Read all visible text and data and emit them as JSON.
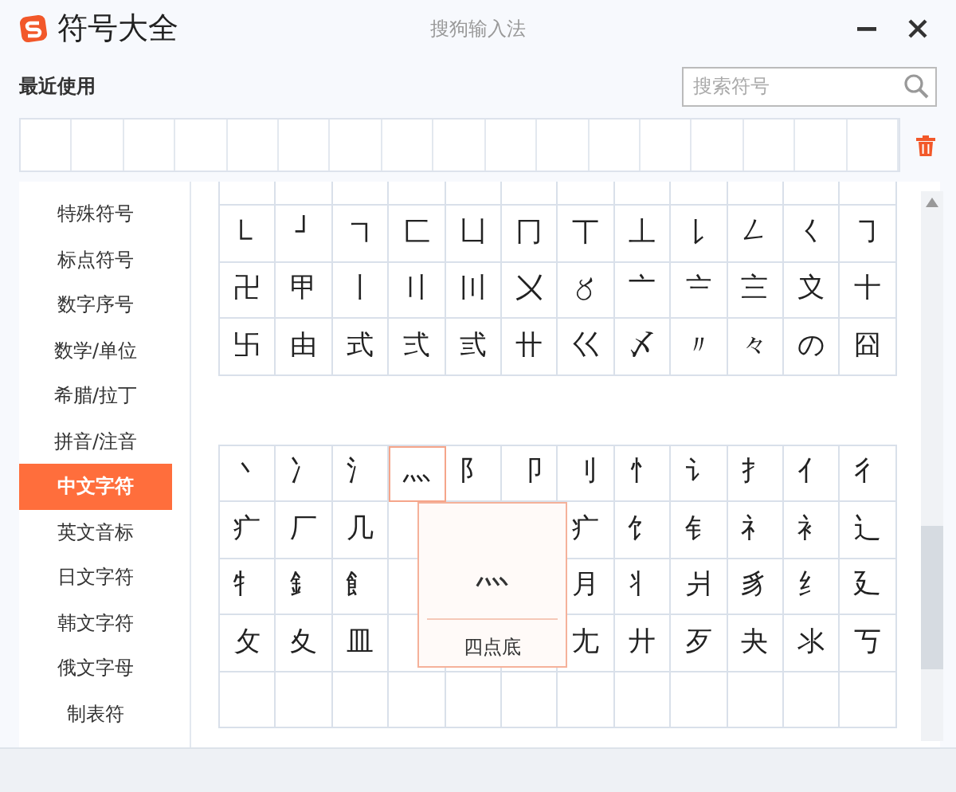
{
  "window": {
    "title": "符号大全",
    "app_name": "搜狗输入法"
  },
  "recent": {
    "title": "最近使用"
  },
  "search": {
    "placeholder": "搜索符号"
  },
  "categories": [
    {
      "label": "特殊符号",
      "selected": false
    },
    {
      "label": "标点符号",
      "selected": false
    },
    {
      "label": "数字序号",
      "selected": false
    },
    {
      "label": "数学/单位",
      "selected": false
    },
    {
      "label": "希腊/拉丁",
      "selected": false
    },
    {
      "label": "拼音/注音",
      "selected": false
    },
    {
      "label": "中文字符",
      "selected": true
    },
    {
      "label": "英文音标",
      "selected": false
    },
    {
      "label": "日文字符",
      "selected": false
    },
    {
      "label": "韩文字符",
      "selected": false
    },
    {
      "label": "俄文字母",
      "selected": false
    },
    {
      "label": "制表符",
      "selected": false
    }
  ],
  "sections": [
    {
      "rows": [
        [
          {
            "symbol": "㇄",
            "hovered": false
          },
          {
            "symbol": "┘",
            "hovered": false
          },
          {
            "symbol": "㇕",
            "hovered": false
          },
          {
            "symbol": "匚",
            "hovered": false
          },
          {
            "symbol": "凵",
            "hovered": false
          },
          {
            "symbol": "冂",
            "hovered": false
          },
          {
            "symbol": "丅",
            "hovered": false
          },
          {
            "symbol": "丄",
            "hovered": false
          },
          {
            "symbol": "㇙",
            "hovered": false
          },
          {
            "symbol": "㇜",
            "hovered": false
          },
          {
            "symbol": "㇛",
            "hovered": false
          },
          {
            "symbol": "㇆",
            "hovered": false
          }
        ],
        [
          {
            "symbol": "卍",
            "hovered": false
          },
          {
            "symbol": "甲",
            "hovered": false
          },
          {
            "symbol": "〡",
            "hovered": false
          },
          {
            "symbol": "〢",
            "hovered": false
          },
          {
            "symbol": "〣",
            "hovered": false
          },
          {
            "symbol": "〤",
            "hovered": false
          },
          {
            "symbol": "〥",
            "hovered": false
          },
          {
            "symbol": "〦",
            "hovered": false
          },
          {
            "symbol": "〧",
            "hovered": false
          },
          {
            "symbol": "〨",
            "hovered": false
          },
          {
            "symbol": "〩",
            "hovered": false
          },
          {
            "symbol": "〸",
            "hovered": false
          }
        ],
        [
          {
            "symbol": "卐",
            "hovered": false
          },
          {
            "symbol": "由",
            "hovered": false
          },
          {
            "symbol": "式",
            "hovered": false
          },
          {
            "symbol": "弍",
            "hovered": false
          },
          {
            "symbol": "弎",
            "hovered": false
          },
          {
            "symbol": "〹",
            "hovered": false
          },
          {
            "symbol": "巜",
            "hovered": false
          },
          {
            "symbol": "〆",
            "hovered": false
          },
          {
            "symbol": "〃",
            "hovered": false
          },
          {
            "symbol": "々",
            "hovered": false
          },
          {
            "symbol": "の",
            "hovered": false
          },
          {
            "symbol": "囧",
            "hovered": false
          }
        ]
      ]
    },
    {
      "rows": [
        [
          {
            "symbol": "丶",
            "hovered": false
          },
          {
            "symbol": "冫",
            "hovered": false
          },
          {
            "symbol": "氵",
            "hovered": false
          },
          {
            "symbol": "灬",
            "hovered": true
          },
          {
            "symbol": "阝",
            "hovered": false
          },
          {
            "symbol": "卩",
            "hovered": false
          },
          {
            "symbol": "刂",
            "hovered": false
          },
          {
            "symbol": "忄",
            "hovered": false
          },
          {
            "symbol": "讠",
            "hovered": false
          },
          {
            "symbol": "扌",
            "hovered": false
          },
          {
            "symbol": "亻",
            "hovered": false
          },
          {
            "symbol": "彳",
            "hovered": false
          }
        ],
        [
          {
            "symbol": "疒",
            "hovered": false
          },
          {
            "symbol": "厂",
            "hovered": false
          },
          {
            "symbol": "几",
            "hovered": false
          },
          null,
          null,
          null,
          {
            "symbol": "疒",
            "hovered": false
          },
          {
            "symbol": "饣",
            "hovered": false
          },
          {
            "symbol": "钅",
            "hovered": false
          },
          {
            "symbol": "礻",
            "hovered": false
          },
          {
            "symbol": "衤",
            "hovered": false
          },
          {
            "symbol": "辶",
            "hovered": false
          }
        ],
        [
          {
            "symbol": "牜",
            "hovered": false
          },
          {
            "symbol": "釒",
            "hovered": false
          },
          {
            "symbol": "飠",
            "hovered": false
          },
          null,
          null,
          null,
          {
            "symbol": "月",
            "hovered": false
          },
          {
            "symbol": "丬",
            "hovered": false
          },
          {
            "symbol": "爿",
            "hovered": false
          },
          {
            "symbol": "豸",
            "hovered": false
          },
          {
            "symbol": "纟",
            "hovered": false
          },
          {
            "symbol": "廴",
            "hovered": false
          }
        ],
        [
          {
            "symbol": "攵",
            "hovered": false
          },
          {
            "symbol": "夊",
            "hovered": false
          },
          {
            "symbol": "皿",
            "hovered": false
          },
          null,
          null,
          null,
          {
            "symbol": "尢",
            "hovered": false
          },
          {
            "symbol": "廾",
            "hovered": false
          },
          {
            "symbol": "歹",
            "hovered": false
          },
          {
            "symbol": "夬",
            "hovered": false
          },
          {
            "symbol": "氺",
            "hovered": false
          },
          {
            "symbol": "丂",
            "hovered": false
          }
        ]
      ]
    }
  ],
  "tooltip": {
    "symbol": "灬",
    "name": "四点底"
  }
}
